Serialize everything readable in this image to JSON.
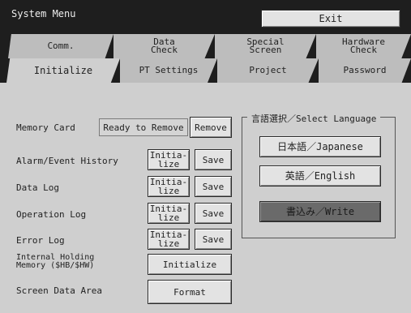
{
  "window": {
    "title": "System Menu",
    "exit_label": "Exit"
  },
  "tabs": {
    "top_row": [
      {
        "label": "Comm."
      },
      {
        "label": "Data\nCheck"
      },
      {
        "label": "Special\nScreen"
      },
      {
        "label": "Hardware\nCheck"
      }
    ],
    "bottom_row": [
      {
        "label": "Initialize"
      },
      {
        "label": "PT Settings"
      },
      {
        "label": "Project"
      },
      {
        "label": "Password"
      }
    ],
    "active": "Initialize"
  },
  "initialize": {
    "memory_card": {
      "label": "Memory Card",
      "status": "Ready to Remove",
      "button": "Remove"
    },
    "alarm_event_history": {
      "label": "Alarm/Event History",
      "init_button": "Initia-\nlize",
      "save_button": "Save"
    },
    "data_log": {
      "label": "Data Log",
      "init_button": "Initia-\nlize",
      "save_button": "Save"
    },
    "operation_log": {
      "label": "Operation Log",
      "init_button": "Initia-\nlize",
      "save_button": "Save"
    },
    "error_log": {
      "label": "Error Log",
      "init_button": "Initia-\nlize",
      "save_button": "Save"
    },
    "internal_holding_memory": {
      "label": "Internal Holding\nMemory ($HB/$HW)",
      "button": "Initialize"
    },
    "screen_data_area": {
      "label": "Screen Data Area",
      "button": "Format"
    }
  },
  "language": {
    "group_title": "言語選択／Select Language",
    "japanese": "日本語／Japanese",
    "english": "英語／English",
    "write": "書込み／Write"
  }
}
